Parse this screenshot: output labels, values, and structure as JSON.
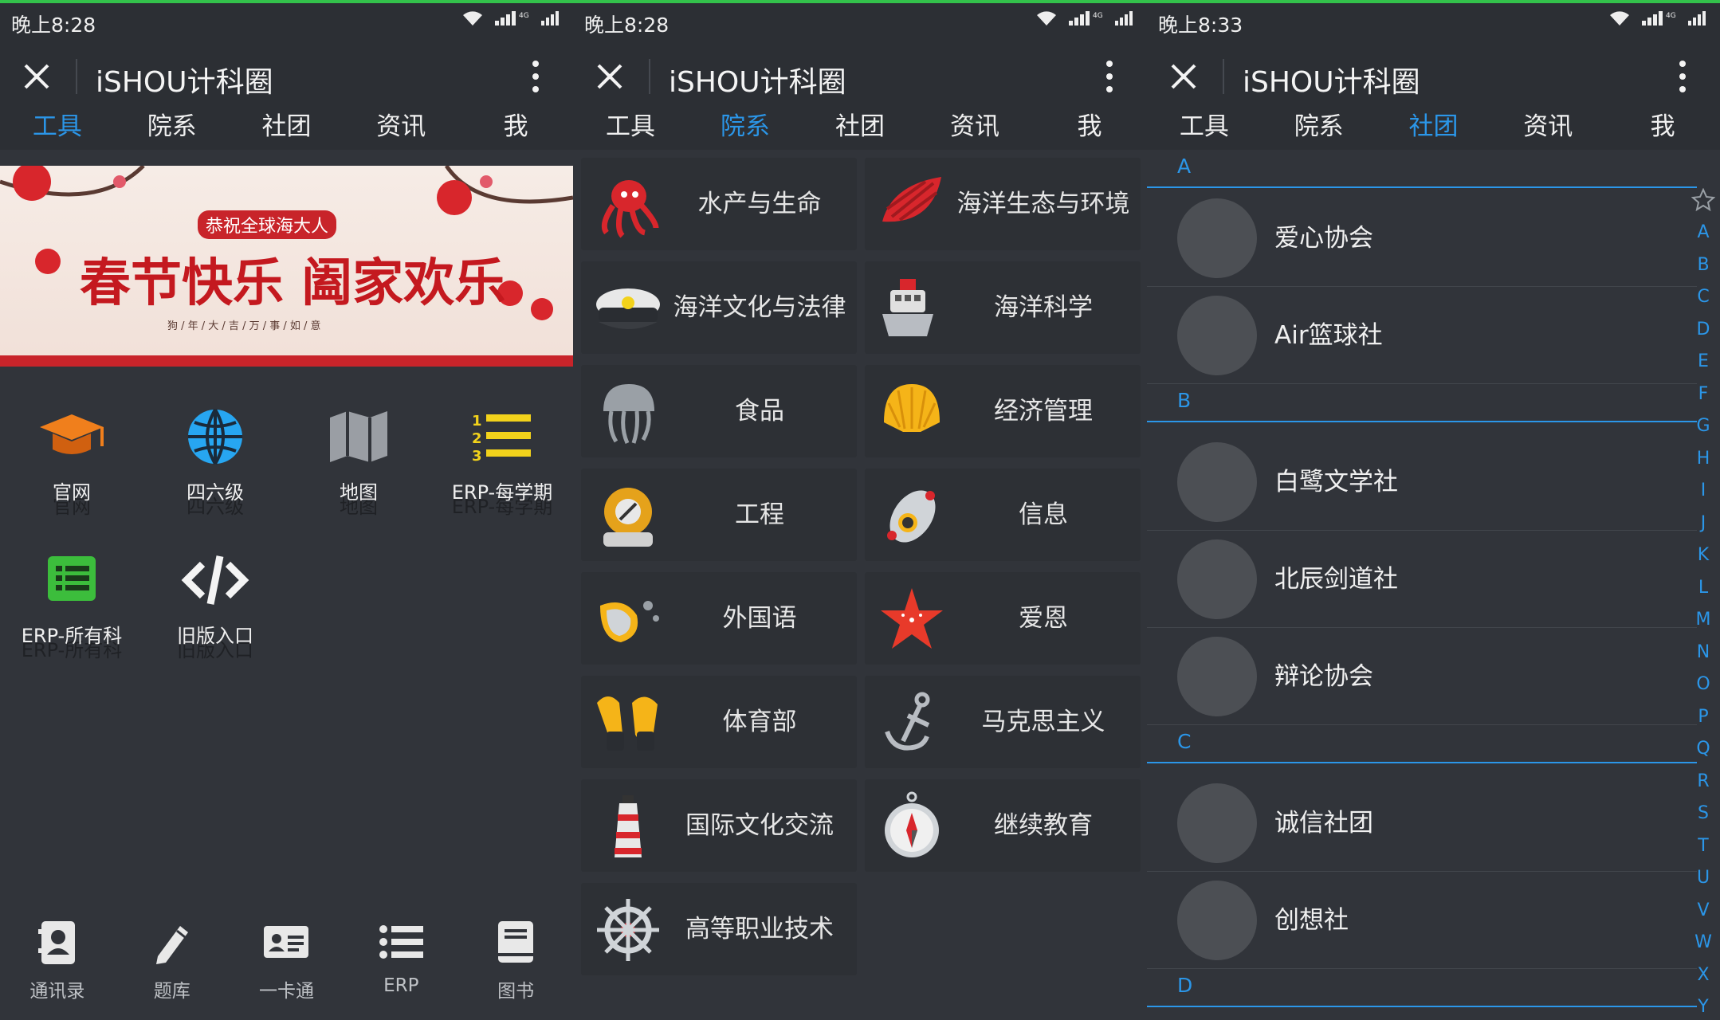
{
  "status_bar": {
    "time_left": "晚上8:28",
    "time_mid": "晚上8:28",
    "time_right": "晚上8:33"
  },
  "app": {
    "title": "iSHOU计科圈"
  },
  "tabs": [
    "工具",
    "院系",
    "社团",
    "资讯",
    "我"
  ],
  "panel1": {
    "active_tab": 0,
    "banner": {
      "main_text": "春节快乐 阖家欢乐",
      "sub_text": "恭祝全球海大人",
      "small_text": "狗 / 年 / 大 / 吉 / 万 / 事 / 如 / 意"
    },
    "tools": [
      {
        "label": "官网",
        "icon": "graduation-cap-icon"
      },
      {
        "label": "四六级",
        "icon": "globe-icon"
      },
      {
        "label": "地图",
        "icon": "map-icon"
      },
      {
        "label": "ERP-每学期",
        "icon": "numbered-list-icon"
      },
      {
        "label": "ERP-所有科",
        "icon": "list-board-icon"
      },
      {
        "label": "旧版入口",
        "icon": "code-icon"
      }
    ],
    "bottom_nav": [
      {
        "label": "通讯录",
        "icon": "contacts-icon"
      },
      {
        "label": "题库",
        "icon": "pencil-icon"
      },
      {
        "label": "一卡通",
        "icon": "id-card-icon"
      },
      {
        "label": "ERP",
        "icon": "list-icon"
      },
      {
        "label": "图书",
        "icon": "book-icon"
      }
    ]
  },
  "panel2": {
    "active_tab": 1,
    "departments": [
      {
        "label": "水产与生命",
        "icon": "octopus-icon"
      },
      {
        "label": "海洋生态与环境",
        "icon": "shell-icon"
      },
      {
        "label": "海洋文化与法律",
        "icon": "captain-hat-icon"
      },
      {
        "label": "海洋科学",
        "icon": "ship-icon"
      },
      {
        "label": "食品",
        "icon": "jellyfish-icon"
      },
      {
        "label": "经济管理",
        "icon": "scallop-icon"
      },
      {
        "label": "工程",
        "icon": "diving-helmet-icon"
      },
      {
        "label": "信息",
        "icon": "submarine-icon"
      },
      {
        "label": "外国语",
        "icon": "diving-mask-icon"
      },
      {
        "label": "爱恩",
        "icon": "starfish-icon"
      },
      {
        "label": "体育部",
        "icon": "flippers-icon"
      },
      {
        "label": "马克思主义",
        "icon": "anchor-icon"
      },
      {
        "label": "国际文化交流",
        "icon": "lighthouse-icon"
      },
      {
        "label": "继续教育",
        "icon": "compass-icon"
      },
      {
        "label": "高等职业技术",
        "icon": "ship-wheel-icon"
      }
    ]
  },
  "panel3": {
    "active_tab": 2,
    "sections": [
      {
        "letter": "A",
        "clubs": [
          "爱心协会",
          "Air篮球社"
        ]
      },
      {
        "letter": "B",
        "clubs": [
          "白鹭文学社",
          "北辰剑道社",
          "辩论协会"
        ]
      },
      {
        "letter": "C",
        "clubs": [
          "诚信社团",
          "创想社"
        ]
      },
      {
        "letter": "D",
        "clubs": []
      }
    ],
    "index_letters": [
      "A",
      "B",
      "C",
      "D",
      "E",
      "F",
      "G",
      "H",
      "I",
      "J",
      "K",
      "L",
      "M",
      "N",
      "O",
      "P",
      "Q",
      "R",
      "S",
      "T",
      "U",
      "V",
      "W",
      "X",
      "Y"
    ]
  },
  "colors": {
    "accent": "#2b96e8",
    "background": "#31343a",
    "status_green": "#33c24b"
  }
}
